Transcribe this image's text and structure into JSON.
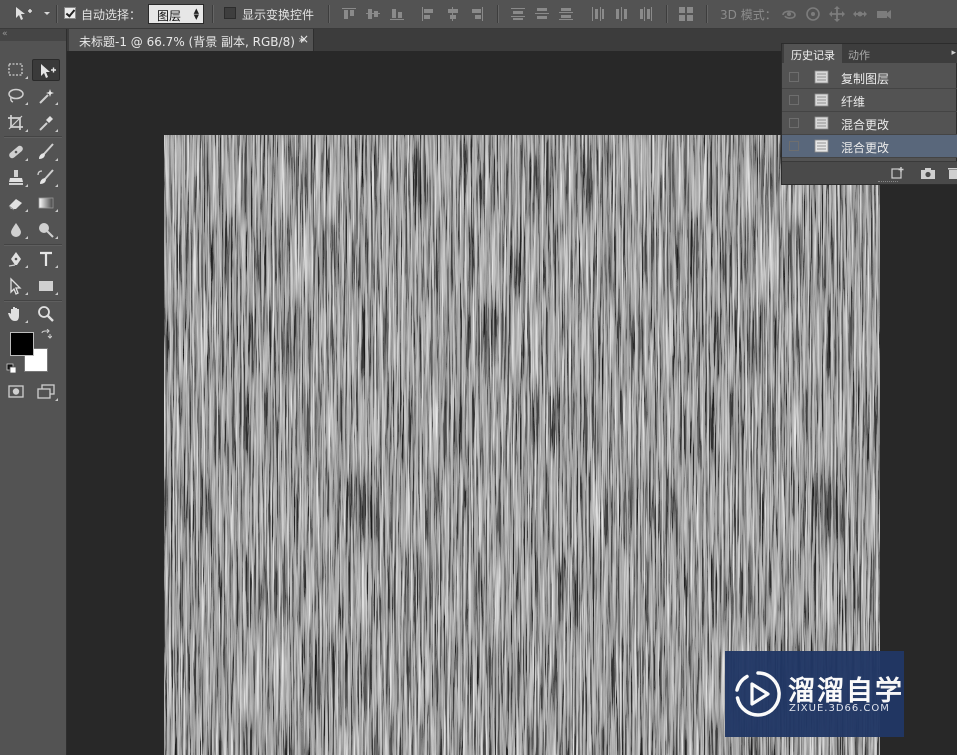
{
  "options_bar": {
    "tool_icon": "move-tool-icon",
    "auto_select_label": "自动选择：",
    "auto_select_checked": true,
    "auto_select_target": "图层",
    "show_transform_label": "显示变换控件",
    "show_transform_checked": false,
    "mode_3d_label": "3D 模式："
  },
  "document": {
    "tab_title": "未标题-1 @ 66.7% (背景 副本, RGB/8) *",
    "close_glyph": "×",
    "canvas_texture": "fibers-noise-black-white"
  },
  "toolbar": {
    "grip": "«",
    "foreground_color": "#000000",
    "background_color": "#ffffff"
  },
  "history_panel": {
    "tabs": [
      "历史记录",
      "动作"
    ],
    "menu_glyph": "▸",
    "items": [
      {
        "label": "复制图层",
        "selected": false
      },
      {
        "label": "纤维",
        "selected": false
      },
      {
        "label": "混合更改",
        "selected": false
      },
      {
        "label": "混合更改",
        "selected": true
      }
    ]
  },
  "watermark": {
    "name": "溜溜自学",
    "domain": "ZIXUE.3D66.COM"
  },
  "colors": {
    "panel_bg": "#535353",
    "workspace_bg": "#282828",
    "selected_row": "#59677b",
    "watermark_bg": "#213765"
  }
}
